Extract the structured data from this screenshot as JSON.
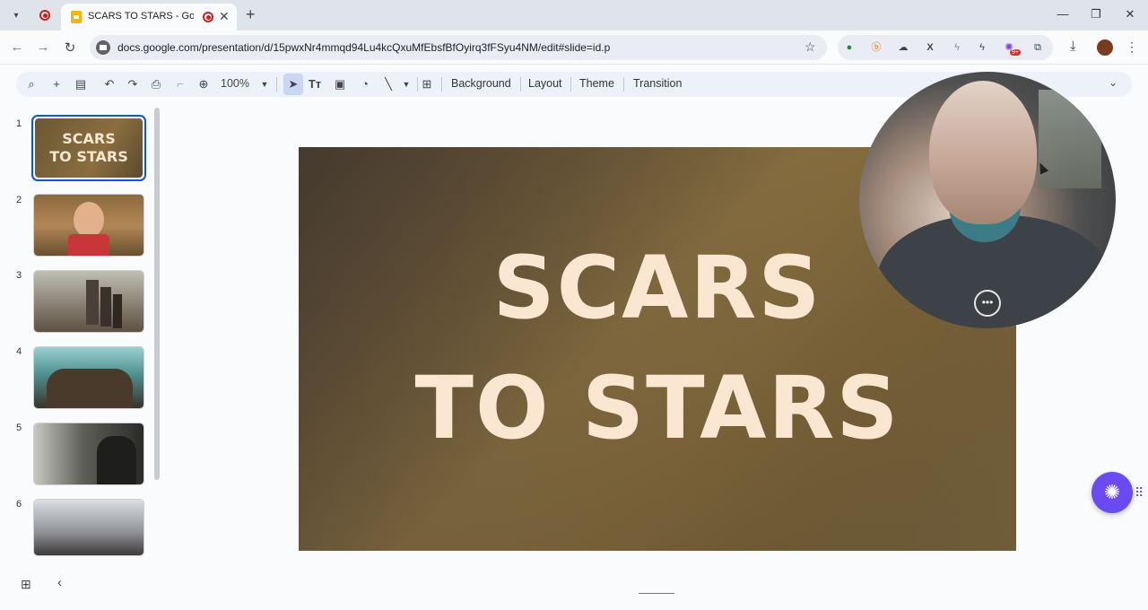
{
  "browser": {
    "tab_title": "SCARS TO STARS - Google S",
    "url": "docs.google.com/presentation/d/15pwxNr4mmqd94Lu4kcQxuMfEbsfBfOyirq3fFSyu4NM/edit#slide=id.p",
    "ext_badge": "9+"
  },
  "toolbar": {
    "zoom": "100%",
    "background_label": "Background",
    "layout_label": "Layout",
    "theme_label": "Theme",
    "transition_label": "Transition"
  },
  "slides": [
    {
      "number": "1",
      "title": "SCARS TO STARS"
    },
    {
      "number": "2"
    },
    {
      "number": "3"
    },
    {
      "number": "4"
    },
    {
      "number": "5"
    },
    {
      "number": "6"
    }
  ],
  "thumb1_title": "SCARS TO STARS",
  "current_slide": {
    "title_line1": "SCARS",
    "title_line2": "TO STARS"
  },
  "colors": {
    "accent": "#0b57d0",
    "fab": "#6a4af2",
    "slide_text": "#fbe6d2"
  }
}
